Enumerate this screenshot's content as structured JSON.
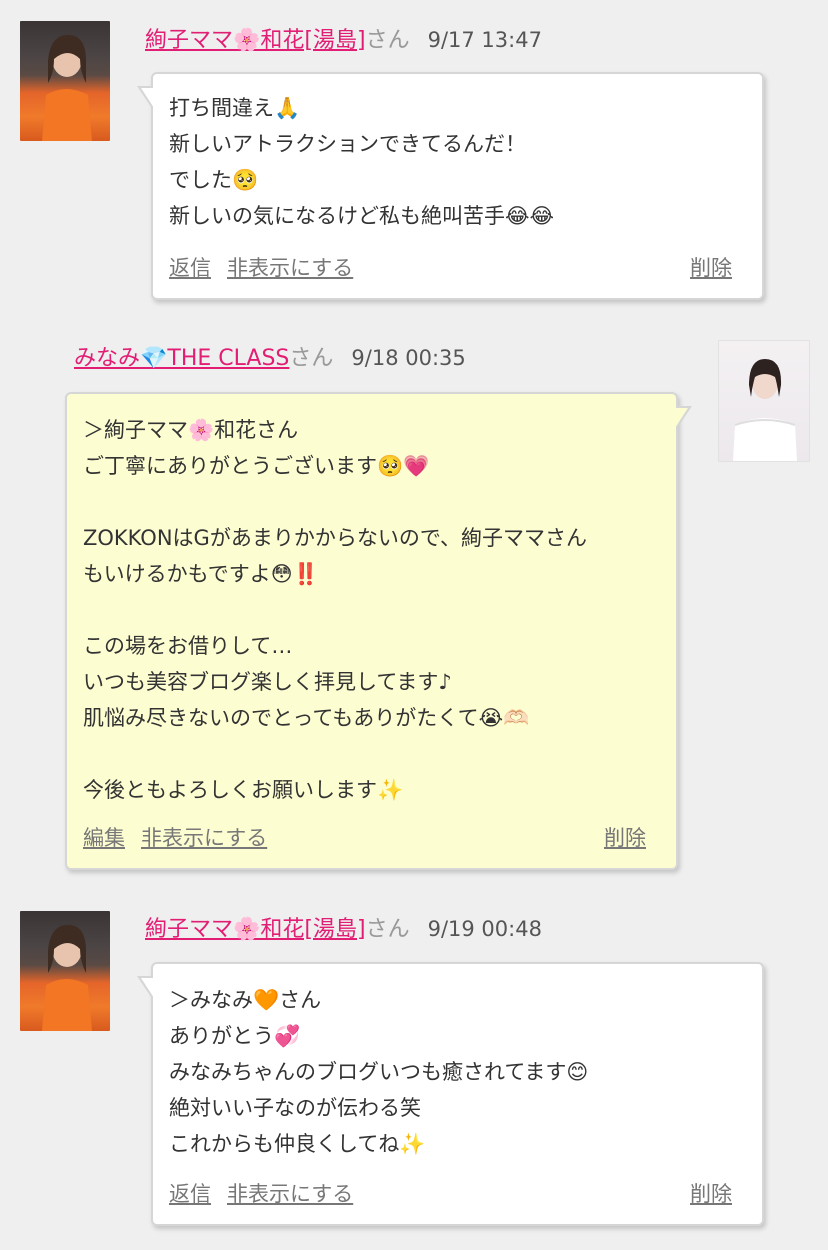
{
  "comments": [
    {
      "username": "絢子ママ🌸和花[湯島]",
      "honorific": "さん",
      "time": "9/17 13:47",
      "body": "打ち間違え🙏\n新しいアトラクションできてるんだ！\nでした🥺\n新しいの気になるけど私も絶叫苦手😂😂",
      "actions": {
        "primary": "返信",
        "hide": "非表示にする",
        "delete": "削除"
      }
    },
    {
      "username": "みなみ💎THE CLASS",
      "honorific": "さん",
      "time": "9/18 00:35",
      "body": "＞絢子ママ🌸和花さん\nご丁寧にありがとうございます🥺💗\n\nZOKKONはGがあまりかからないので、絢子ママさん\nもいけるかもですよ😳‼️\n\nこの場をお借りして…\nいつも美容ブログ楽しく拝見してます♪\n肌悩み尽きないのでとってもありがたくて😭🫶🏻\n\n今後ともよろしくお願いします✨",
      "actions": {
        "primary": "編集",
        "hide": "非表示にする",
        "delete": "削除"
      }
    },
    {
      "username": "絢子ママ🌸和花[湯島]",
      "honorific": "さん",
      "time": "9/19 00:48",
      "body": "＞みなみ🧡さん\nありがとう💞\nみなみちゃんのブログいつも癒されてます😊\n絶対いい子なのが伝わる笑\nこれからも仲良くしてね✨",
      "actions": {
        "primary": "返信",
        "hide": "非表示にする",
        "delete": "削除"
      }
    }
  ],
  "colors": {
    "username": "#e21e74",
    "background": "#efefef",
    "white_bubble": "#ffffff",
    "yellow_bubble": "#fdfdd2",
    "action_link": "#777777"
  }
}
